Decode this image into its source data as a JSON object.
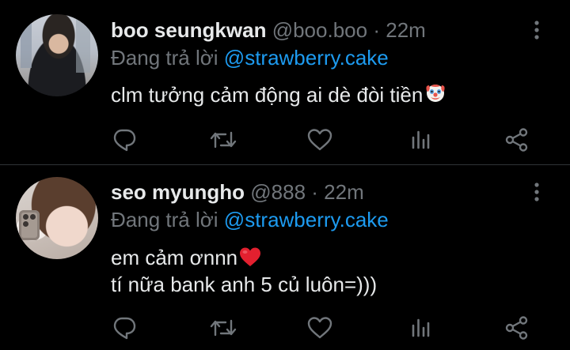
{
  "tweets": [
    {
      "name": "boo seungkwan",
      "handle": "@boo.boo",
      "separator": "·",
      "time": "22m",
      "replying_prefix": "Đang trả lời",
      "replying_to": "@strawberry.cake",
      "lines": [
        "clm tưởng cảm động ai dè đòi tiền"
      ],
      "emoji": "clown-face"
    },
    {
      "name": "seo myungho",
      "handle": "@888",
      "separator": "·",
      "time": "22m",
      "replying_prefix": "Đang trả lời",
      "replying_to": "@strawberry.cake",
      "lines": [
        "em cảm ơnnn",
        "tí nữa bank anh 5 củ luôn=)))"
      ],
      "emoji": "red-heart"
    }
  ],
  "icons": {
    "more": "more-vertical-icon",
    "reply": "reply-icon",
    "retweet": "retweet-icon",
    "like": "heart-icon",
    "stats": "stats-icon",
    "share": "share-icon"
  },
  "colors": {
    "background": "#000000",
    "text": "#e7e9ea",
    "muted": "#71767b",
    "accent": "#1d9bf0",
    "divider": "#2f3336"
  }
}
